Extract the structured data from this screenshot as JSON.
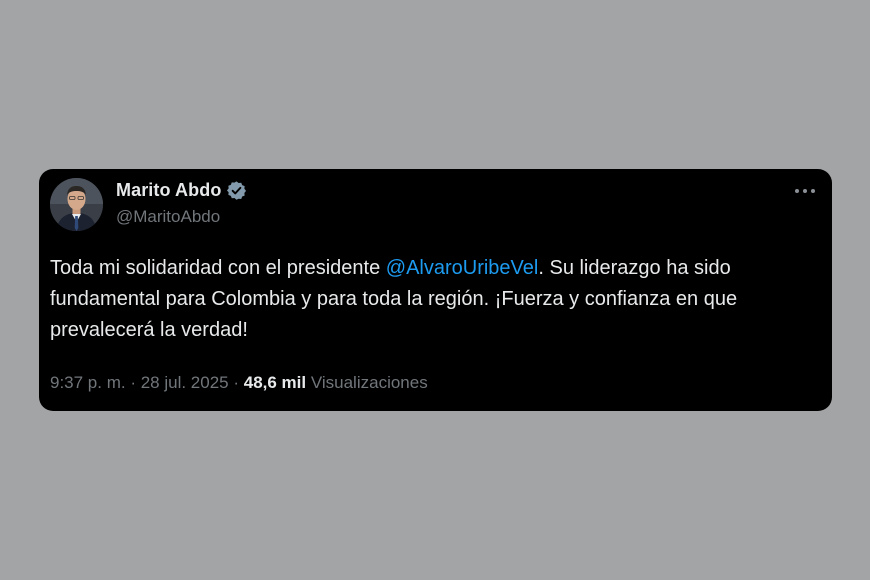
{
  "tweet": {
    "author": {
      "display_name": "Marito Abdo",
      "handle": "@MaritoAbdo",
      "verified": true,
      "verified_badge_color": "#829aab"
    },
    "text": {
      "before_mention": "Toda mi solidaridad con el presidente ",
      "mention": "@AlvaroUribeVel",
      "after_mention": ". Su liderazgo ha sido fundamental para Colombia y para toda la región. ¡Fuerza y confianza en que prevalecerá la verdad!"
    },
    "meta": {
      "time": "9:37 p. m.",
      "separator": " · ",
      "date": "28 jul. 2025",
      "views_count": "48,6 mil",
      "views_label": "Visualizaciones"
    },
    "icons": {
      "verified": "verified-badge-icon",
      "more": "more-options-icon"
    }
  },
  "colors": {
    "background": "#a3a4a6",
    "card": "#000000",
    "text_primary": "#e7e9ea",
    "text_secondary": "#71767b",
    "link": "#1d9bf0"
  }
}
